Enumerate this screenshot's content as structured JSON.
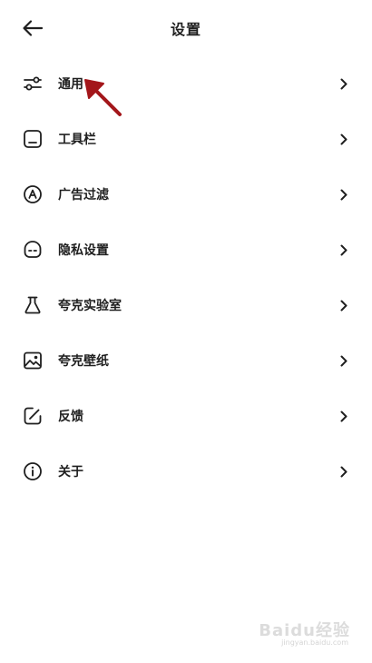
{
  "header": {
    "title": "设置",
    "back_icon": "arrow-left-icon"
  },
  "menu": {
    "items": [
      {
        "label": "通用",
        "icon": "sliders-icon"
      },
      {
        "label": "工具栏",
        "icon": "toolbar-icon"
      },
      {
        "label": "广告过滤",
        "icon": "ad-block-icon"
      },
      {
        "label": "隐私设置",
        "icon": "privacy-mask-icon"
      },
      {
        "label": "夸克实验室",
        "icon": "flask-icon"
      },
      {
        "label": "夸克壁纸",
        "icon": "image-icon"
      },
      {
        "label": "反馈",
        "icon": "edit-feedback-icon"
      },
      {
        "label": "关于",
        "icon": "info-icon"
      }
    ]
  },
  "annotation": {
    "color": "#a3161a"
  },
  "watermark": {
    "brand": "Baidu经验",
    "url": "jingyan.baidu.com"
  }
}
